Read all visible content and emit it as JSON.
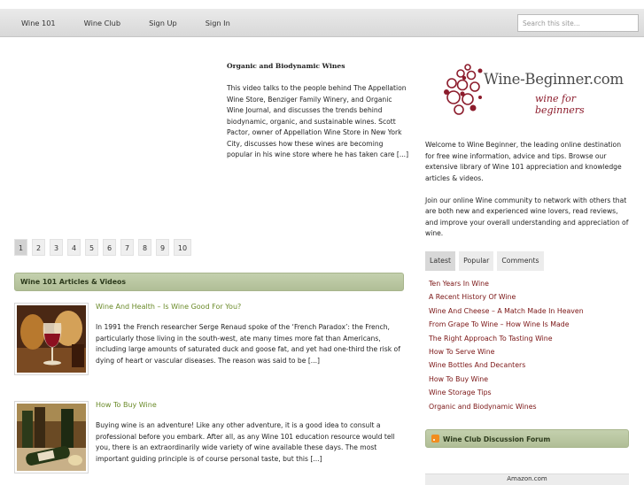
{
  "nav": {
    "items": [
      "Wine 101",
      "Wine Club",
      "Sign Up",
      "Sign In"
    ],
    "search_placeholder": "Search this site..."
  },
  "feature": {
    "title": "Organic and Biodynamic Wines",
    "text": "This video talks to the people behind The Appellation Wine Store, Benziger Family Winery, and Organic Wine Journal, and discusses the trends behind biodynamic, organic, and sustainable wines. Scott Pactor, owner of Appellation Wine Store in New York City, discusses how these wines are becoming popular in his wine store where he has taken care [...]"
  },
  "pager": {
    "pages": [
      "1",
      "2",
      "3",
      "4",
      "5",
      "6",
      "7",
      "8",
      "9",
      "10"
    ],
    "current": "1"
  },
  "section": {
    "title": "Wine 101 Articles & Videos"
  },
  "articles": [
    {
      "title": "Wine And Health – Is Wine Good For You?",
      "text": "In 1991 the French researcher Serge Renaud spoke of the ‘French Paradox’: the French, particularly those living in the south-west, ate many times more fat than Americans, including large amounts of saturated duck and goose fat, and yet had one-third the risk of dying of heart or vascular diseases. The reason was said to be [...]"
    },
    {
      "title": "How To Buy Wine",
      "text": "Buying wine is an adventure! Like any other adventure, it is a good idea to consult a professional before you embark. After all, as any Wine 101 education resource would tell you, there is an extraordinarily wide variety of wine available these days. The most important guiding principle is of course personal taste, but this [...]"
    }
  ],
  "logo": {
    "name": "Wine-Beginner.com",
    "tagline": "wine for beginners",
    "grape_color": "#8c1c2c"
  },
  "welcome": {
    "p1": "Welcome to Wine Beginner, the leading online destination for free wine information, advice and tips. Browse our extensive library of Wine 101 appreciation and knowledge articles & videos.",
    "p2": "Join our online Wine community to network with others that are both new and experienced wine lovers, read reviews, and improve your overall understanding and appreciation of wine."
  },
  "tabs": [
    "Latest",
    "Popular",
    "Comments"
  ],
  "latest": [
    "Ten Years In Wine",
    "A Recent History Of Wine",
    "Wine And Cheese – A Match Made In Heaven",
    "From Grape To Wine – How Wine Is Made",
    "The Right Approach To Tasting Wine",
    "How To Serve Wine",
    "Wine Bottles And Decanters",
    "How To Buy Wine",
    "Wine Storage Tips",
    "Organic and Biodynamic Wines"
  ],
  "forum": {
    "title": "Wine Club Discussion Forum"
  },
  "amazon": {
    "label": "Amazon.com"
  },
  "colors": {
    "accent_green": "#b0be96",
    "link_red": "#7a1414",
    "title_green": "#6b8b2a"
  }
}
